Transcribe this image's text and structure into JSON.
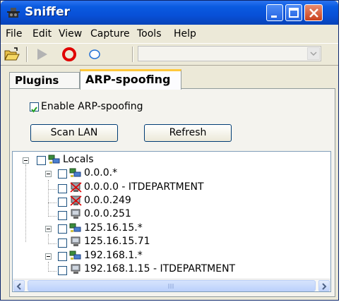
{
  "window": {
    "title": "Sniffer"
  },
  "menu": [
    "File",
    "Edit",
    "View",
    "Capture",
    "Tools",
    "Help"
  ],
  "toolbar": {
    "icons": [
      "open-folder-icon",
      "play-icon",
      "stop-icon",
      "pause-icon"
    ],
    "combo_value": ""
  },
  "tabs": [
    {
      "label": "Plugins",
      "active": false
    },
    {
      "label": "ARP-spoofing",
      "active": true
    }
  ],
  "arp": {
    "enable_label": "Enable ARP-spoofing",
    "enable_checked": true,
    "scan_label": "Scan LAN",
    "refresh_label": "Refresh"
  },
  "tree": {
    "root": "Locals",
    "groups": [
      {
        "label": "0.0.0.*",
        "hosts": [
          "0.0.0.0 - ITDEPARTMENT",
          "0.0.0.249",
          "0.0.0.251"
        ]
      },
      {
        "label": "125.16.15.*",
        "hosts": [
          "125.16.15.71"
        ]
      },
      {
        "label": "192.168.1.*",
        "hosts": [
          "192.168.1.15 - ITDEPARTMENT"
        ]
      }
    ]
  },
  "colors": {
    "title_bar": "#0a5be0",
    "close_button": "#c9401c",
    "check_mark": "#21a121",
    "stop_red": "#e00000"
  }
}
